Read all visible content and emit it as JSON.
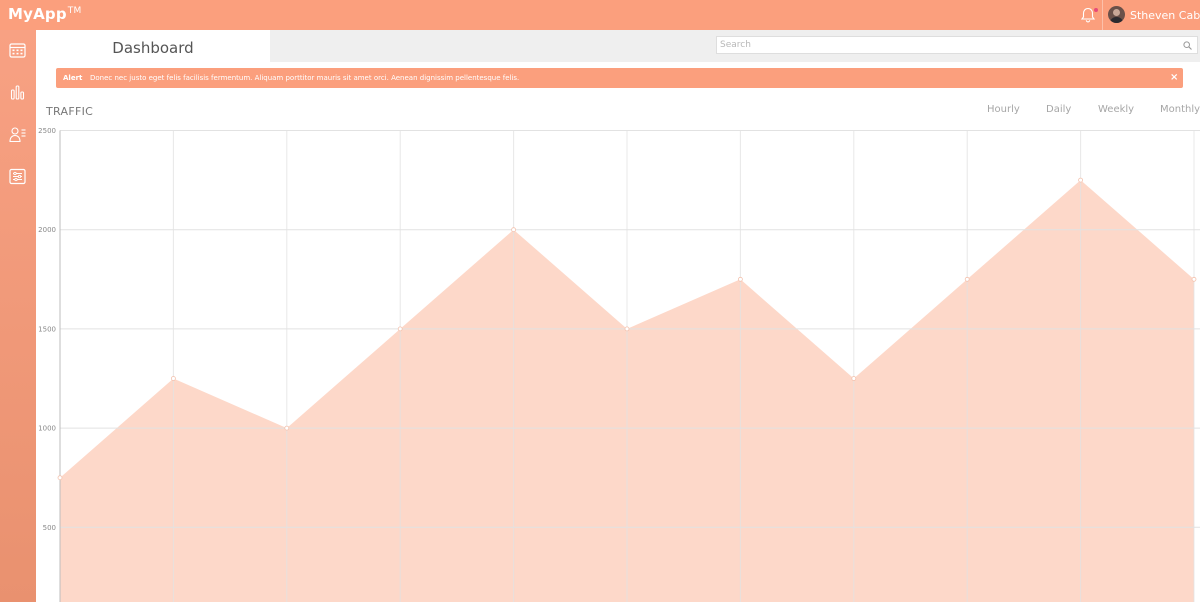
{
  "app": {
    "name": "MyApp",
    "trademark": "TM",
    "user_name": "Stheven Cabral"
  },
  "icons": {
    "notification": "bell-icon",
    "sidebar": [
      "calendar-icon",
      "bar-chart-icon",
      "user-list-icon",
      "settings-panel-icon"
    ],
    "search": "search-icon",
    "close": "close-icon"
  },
  "tabs": {
    "active_label": "Dashboard"
  },
  "search": {
    "placeholder": "Search"
  },
  "alert": {
    "label": "Alert",
    "message": "Donec nec justo eget felis facilisis fermentum. Aliquam porttitor mauris sit amet orci. Aenean dignissim pellentesque felis.",
    "close_label": "×"
  },
  "traffic": {
    "title": "TRAFFIC",
    "ranges": [
      "Hourly",
      "Daily",
      "Weekly",
      "Monthly"
    ]
  },
  "colors": {
    "brand": "#fb9f7d",
    "area_fill": "#fdd8c9",
    "grid": "#e2e2e2",
    "notification_dot": "#e84a78"
  },
  "chart_data": {
    "type": "area",
    "title": "",
    "xlabel": "",
    "ylabel": "",
    "y_ticks": [
      500,
      1000,
      1500,
      2000,
      2500
    ],
    "ylim": [
      0,
      2500
    ],
    "grid": true,
    "series": [
      {
        "values": [
          750,
          1250,
          1000,
          1500,
          2000,
          1500,
          1750,
          1250,
          1750,
          2250,
          1750
        ]
      }
    ]
  }
}
